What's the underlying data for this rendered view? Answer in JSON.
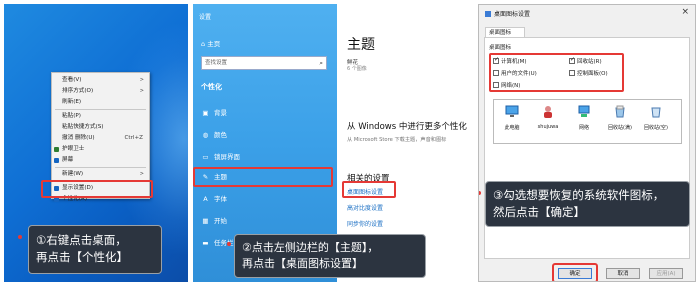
{
  "panel1": {
    "context_menu": [
      {
        "label": "查看(V)",
        "arrow": ">"
      },
      {
        "label": "排序方式(O)",
        "arrow": ">"
      },
      {
        "label": "刷新(E)"
      },
      {
        "sep": true
      },
      {
        "label": "粘贴(P)"
      },
      {
        "label": "粘贴快捷方式(S)"
      },
      {
        "label": "撤消 删除(U)",
        "shortcut": "Ctrl+Z"
      },
      {
        "label": "护眼卫士",
        "icon": "shield-icon",
        "icon_color": "#2e7d32"
      },
      {
        "label": "屏幕",
        "icon": "monitor-icon",
        "icon_color": "#1565c0"
      },
      {
        "sep": true
      },
      {
        "label": "新建(W)",
        "arrow": ">"
      },
      {
        "sep": true
      },
      {
        "label": "显示设置(D)",
        "icon": "display-icon",
        "icon_color": "#1565c0"
      },
      {
        "label": "个性化(R)",
        "icon": "personalize-icon",
        "icon_color": "#1565c0"
      }
    ],
    "callout_line1": "①右键点击桌面，",
    "callout_line2": "再点击【个性化】"
  },
  "panel2": {
    "window_title": "设置",
    "home": "主页",
    "search_placeholder": "查找设置",
    "section": "个性化",
    "nav": [
      {
        "label": "背景",
        "icon": "image-icon",
        "glyph": "▣"
      },
      {
        "label": "颜色",
        "icon": "palette-icon",
        "glyph": "◍"
      },
      {
        "label": "锁屏界面",
        "icon": "lock-screen-icon",
        "glyph": "▭"
      },
      {
        "label": "主题",
        "icon": "theme-icon",
        "glyph": "✎"
      },
      {
        "label": "字体",
        "icon": "font-icon",
        "glyph": "A"
      },
      {
        "label": "开始",
        "icon": "start-icon",
        "glyph": "▦"
      },
      {
        "label": "任务栏",
        "icon": "taskbar-icon",
        "glyph": "▬"
      }
    ],
    "main_title": "主题",
    "theme_name": "鲜花",
    "theme_count": "6 个图像",
    "store_heading": "从 Windows 中进行更多个性化",
    "store_desc": "从 Microsoft Store 下载主题，声音和图标",
    "related_heading": "相关的设置",
    "links": [
      "桌面图标设置",
      "高对比度设置",
      "同步你的设置"
    ],
    "callout_line1": "②点击左侧边栏的【主题】，",
    "callout_line2": "再点击【桌面图标设置】"
  },
  "panel3": {
    "dialog_title": "桌面图标设置",
    "close_glyph": "×",
    "tab": "桌面图标",
    "group_label": "桌面图标",
    "checkboxes": [
      {
        "label": "计算机(M)",
        "checked": true
      },
      {
        "label": "回收站(R)",
        "checked": true
      },
      {
        "label": "用户的文件(U)",
        "checked": false
      },
      {
        "label": "控制面板(O)",
        "checked": false
      },
      {
        "label": "网络(N)",
        "checked": false
      }
    ],
    "icons": [
      {
        "label": "此电脑",
        "icon": "computer-icon"
      },
      {
        "label": "shujuwa",
        "icon": "user-folder-icon"
      },
      {
        "label": "网络",
        "icon": "network-icon"
      },
      {
        "label": "回收站(满)",
        "icon": "recycle-bin-full-icon"
      },
      {
        "label": "回收站(空)",
        "icon": "recycle-bin-empty-icon"
      }
    ],
    "callout_line1": "③勾选想要恢复的系统软件图标，",
    "callout_line2": "然后点击【确定】",
    "ok": "确定",
    "cancel": "取消",
    "apply": "应用(A)"
  }
}
